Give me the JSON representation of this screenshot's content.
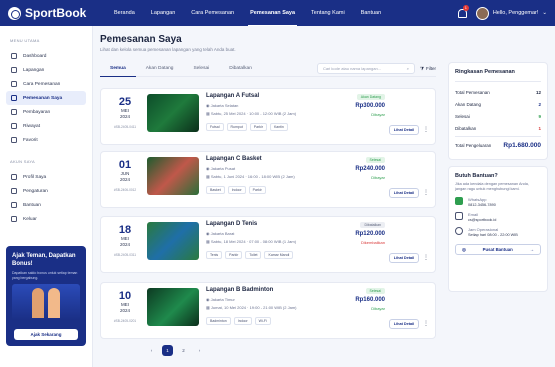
{
  "brand": "SportBook",
  "nav": [
    "Beranda",
    "Lapangan",
    "Cara Pemesanan",
    "Pemesanan Saya",
    "Tentang Kami",
    "Bantuan"
  ],
  "notif_count": "1",
  "user": "Hello, Penggemar!",
  "sidebar": {
    "h1": "MENU UTAMA",
    "items": [
      "Dashboard",
      "Lapangan",
      "Cara Pemesanan",
      "Pemesanan Saya",
      "Pembayaran",
      "Riwayat",
      "Favorit"
    ],
    "h2": "AKUN SAYA",
    "items2": [
      "Profil Saya",
      "Pengaturan",
      "Bantuan",
      "Keluar"
    ]
  },
  "promo": {
    "title": "Ajak Teman, Dapatkan Bonus!",
    "desc": "Dapatkan saldo bonus untuk setiap teman yang bergabung.",
    "btn": "Ajak Sekarang"
  },
  "page": {
    "title": "Pemesanan Saya",
    "subtitle": "Lihat dan kelola semua pemesanan lapangan yang telah Anda buat."
  },
  "tabs": [
    "Semua",
    "Akan Datang",
    "Selesai",
    "Dibatalkan"
  ],
  "search_placeholder": "Cari kode atau nama lapangan...",
  "filter": "Filter",
  "bookings": [
    {
      "day": "25",
      "month": "MEI",
      "year": "2024",
      "id": "#SB-2405-0411",
      "name": "Lapangan A Futsal",
      "loc": "Jakarta Selatan",
      "time": "Sabtu, 25 Mei 2024   ·   10:00 - 12:00 WIB (2 Jam)",
      "tags": [
        "Futsal",
        "Rumput",
        "Parkir",
        "Kantin"
      ],
      "status": "Akan Datang",
      "price": "Rp300.000",
      "pay": "Dibayar",
      "detail": "Lihat Detail"
    },
    {
      "day": "01",
      "month": "JUN",
      "year": "2024",
      "id": "#SB-2406-0012",
      "name": "Lapangan C Basket",
      "loc": "Jakarta Pusat",
      "time": "Sabtu, 1 Juni 2024   ·   16:00 - 18:00 WIB (2 Jam)",
      "tags": [
        "Basket",
        "Indoor",
        "Parkir"
      ],
      "status": "Selesai",
      "price": "Rp240.000",
      "pay": "Dibayar",
      "detail": "Lihat Detail"
    },
    {
      "day": "18",
      "month": "MEI",
      "year": "2024",
      "id": "#SB-2405-0311",
      "name": "Lapangan D Tenis",
      "loc": "Jakarta Barat",
      "time": "Sabtu, 18 Mei 2024   ·   07:00 - 08:00 WIB (1 Jam)",
      "tags": [
        "Tenis",
        "Parkir",
        "Toilet",
        "Kamar Mandi"
      ],
      "status": "Dibatalkan",
      "price": "Rp120.000",
      "pay": "Dikembalikan",
      "detail": "Lihat Detail"
    },
    {
      "day": "10",
      "month": "MEI",
      "year": "2024",
      "id": "#SB-2405-0201",
      "name": "Lapangan B Badminton",
      "loc": "Jakarta Timur",
      "time": "Jumat, 10 Mei 2024   ·   19:00 - 21:00 WIB (2 Jam)",
      "tags": [
        "Badminton",
        "Indoor",
        "Wi-Fi"
      ],
      "status": "Selesai",
      "price": "Rp160.000",
      "pay": "Dibayar",
      "detail": "Lihat Detail"
    }
  ],
  "pages": [
    "1",
    "2"
  ],
  "summary": {
    "title": "Ringkasan Pemesanan",
    "rows": [
      [
        "Total Pemesanan",
        "12"
      ],
      [
        "Akan Datang",
        "2"
      ],
      [
        "Selesai",
        "9"
      ],
      [
        "Dibatalkan",
        "1"
      ]
    ],
    "total_label": "Total Pengeluaran",
    "total": "Rp1.680.000"
  },
  "help": {
    "title": "Butuh Bantuan?",
    "desc": "Jika ada kendala dengan pemesanan Anda, jangan ragu untuk menghubungi kami.",
    "items": [
      [
        "WhatsApp",
        "0812-3456-7890"
      ],
      [
        "Email",
        "cs@sportbook.id"
      ],
      [
        "Jam Operasional",
        "Setiap hari 08:00 - 22:00 WIB"
      ]
    ],
    "btn": "Pusat Bantuan"
  },
  "colors": {
    "primary": "#1a2f86",
    "green": "#2e9e4f",
    "red": "#d93838"
  }
}
